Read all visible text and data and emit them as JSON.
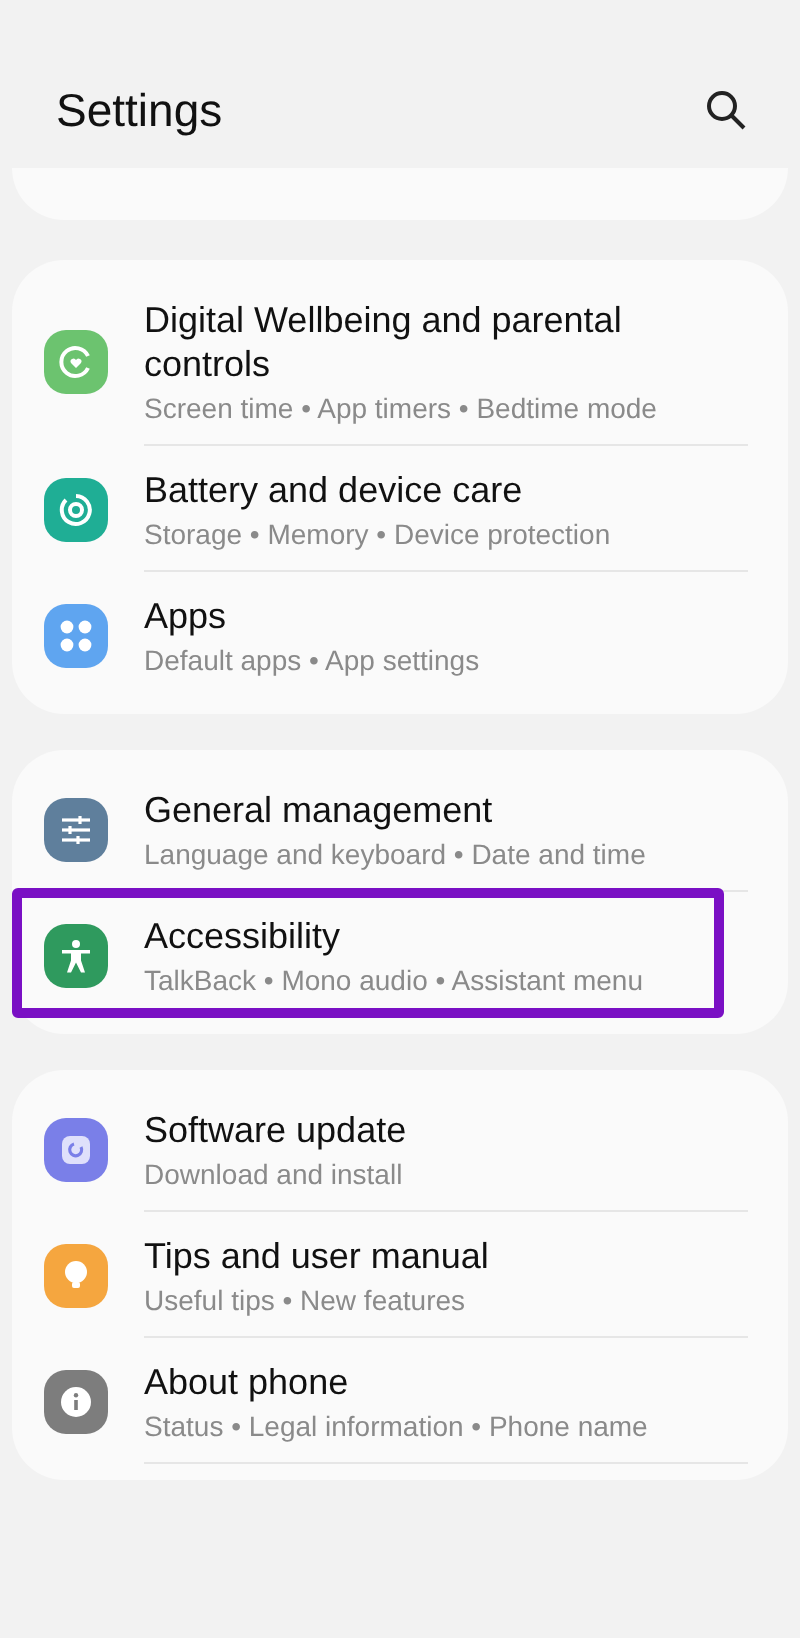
{
  "header": {
    "title": "Settings"
  },
  "groups": [
    {
      "items": [
        {
          "kind": "wellbeing",
          "color": "#6cc36f",
          "title": "Digital Wellbeing and parental controls",
          "subtitle": "Screen time  •  App timers  •  Bedtime mode",
          "highlighted": false
        },
        {
          "kind": "battery",
          "color": "#1fae95",
          "title": "Battery and device care",
          "subtitle": "Storage  •  Memory  •  Device protection",
          "highlighted": false
        },
        {
          "kind": "apps",
          "color": "#5fa5f0",
          "title": "Apps",
          "subtitle": "Default apps  •  App settings",
          "highlighted": false
        }
      ]
    },
    {
      "items": [
        {
          "kind": "sliders",
          "color": "#5f7f9c",
          "title": "General management",
          "subtitle": "Language and keyboard  •  Date and time",
          "highlighted": false
        },
        {
          "kind": "person",
          "color": "#2f9a5e",
          "title": "Accessibility",
          "subtitle": "TalkBack  •  Mono audio  •  Assistant menu",
          "highlighted": true
        }
      ]
    },
    {
      "items": [
        {
          "kind": "update",
          "color": "#7a7fe8",
          "title": "Software update",
          "subtitle": "Download and install",
          "highlighted": false
        },
        {
          "kind": "bulb",
          "color": "#f5a63f",
          "title": "Tips and user manual",
          "subtitle": "Useful tips  •  New features",
          "highlighted": false
        },
        {
          "kind": "info",
          "color": "#7d7d7d",
          "title": "About phone",
          "subtitle": "Status  •  Legal information  •  Phone name",
          "highlighted": false
        }
      ]
    }
  ]
}
